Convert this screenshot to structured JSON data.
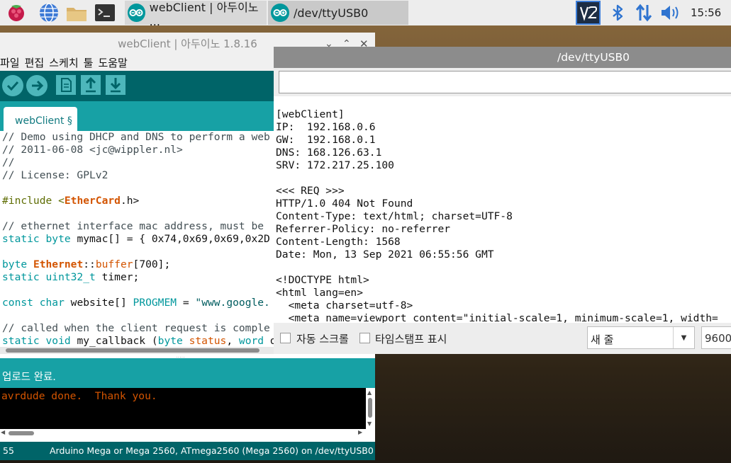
{
  "taskbar": {
    "tasks": [
      {
        "label": "webClient | 아두이노 ..."
      },
      {
        "label": "/dev/ttyUSB0"
      }
    ],
    "clock": "15:56"
  },
  "ide": {
    "title": "webClient | 아두이노 1.8.16",
    "menu": [
      "파일",
      "편집",
      "스케치",
      "툴",
      "도움말"
    ],
    "tab_label": "webClient §",
    "code_lines": [
      [
        {
          "t": "// Demo using DHCP and DNS to perform a web",
          "c": "com"
        }
      ],
      [
        {
          "t": "// 2011-06-08 <jc@wippler.nl>",
          "c": "com"
        }
      ],
      [
        {
          "t": "//",
          "c": "com"
        }
      ],
      [
        {
          "t": "// License: GPLv2",
          "c": "com"
        }
      ],
      [
        {
          "t": "",
          "c": ""
        }
      ],
      [
        {
          "t": "#include <",
          "c": "inc"
        },
        {
          "t": "EtherCard",
          "c": "type"
        },
        {
          "t": ".h>",
          "c": ""
        }
      ],
      [
        {
          "t": "",
          "c": ""
        }
      ],
      [
        {
          "t": "// ethernet interface mac address, must be",
          "c": "com"
        }
      ],
      [
        {
          "t": "static byte",
          "c": "kw"
        },
        {
          "t": " mymac[] = { 0x74,0x69,0x69,0x2D",
          "c": ""
        }
      ],
      [
        {
          "t": "",
          "c": ""
        }
      ],
      [
        {
          "t": "byte ",
          "c": "kw"
        },
        {
          "t": "Ethernet",
          "c": "type"
        },
        {
          "t": "::",
          "c": ""
        },
        {
          "t": "buffer",
          "c": "type2"
        },
        {
          "t": "[700];",
          "c": ""
        }
      ],
      [
        {
          "t": "static uint32_t",
          "c": "kw"
        },
        {
          "t": " timer;",
          "c": ""
        }
      ],
      [
        {
          "t": "",
          "c": ""
        }
      ],
      [
        {
          "t": "const char",
          "c": "kw"
        },
        {
          "t": " website[] ",
          "c": ""
        },
        {
          "t": "PROGMEM",
          "c": "kw"
        },
        {
          "t": " = ",
          "c": ""
        },
        {
          "t": "\"www.google.",
          "c": "str"
        }
      ],
      [
        {
          "t": "",
          "c": ""
        }
      ],
      [
        {
          "t": "// called when the client request is comple",
          "c": "com"
        }
      ],
      [
        {
          "t": "static void",
          "c": "kw"
        },
        {
          "t": " my_callback (",
          "c": ""
        },
        {
          "t": "byte",
          "c": "kw"
        },
        {
          "t": " status",
          "c": "type2"
        },
        {
          "t": ", ",
          "c": ""
        },
        {
          "t": "word",
          "c": "kw"
        },
        {
          "t": " o",
          "c": ""
        }
      ]
    ],
    "status": "업로드 완료.",
    "console_text": "avrdude done.  Thank you.",
    "footer_line": "55",
    "footer_board": "Arduino Mega or Mega 2560, ATmega2560 (Mega 2560) on /dev/ttyUSB0"
  },
  "serial": {
    "title": "/dev/ttyUSB0",
    "input_value": "",
    "output_lines": [
      "[webClient]",
      "IP:  192.168.0.6",
      "GW:  192.168.0.1",
      "DNS: 168.126.63.1",
      "SRV: 172.217.25.100",
      "",
      "<<< REQ >>>",
      "HTTP/1.0 404 Not Found",
      "Content-Type: text/html; charset=UTF-8",
      "Referrer-Policy: no-referrer",
      "Content-Length: 1568",
      "Date: Mon, 13 Sep 2021 06:55:56 GMT",
      "",
      "<!DOCTYPE html>",
      "<html lang=en>",
      "  <meta charset=utf-8>",
      "  <meta name=viewport content=\"initial-scale=1, minimum-scale=1, width="
    ],
    "autoscroll_label": "자동 스크롤",
    "timestamp_label": "타임스탬프 표시",
    "line_ending": "새 줄",
    "baud": "9600"
  }
}
